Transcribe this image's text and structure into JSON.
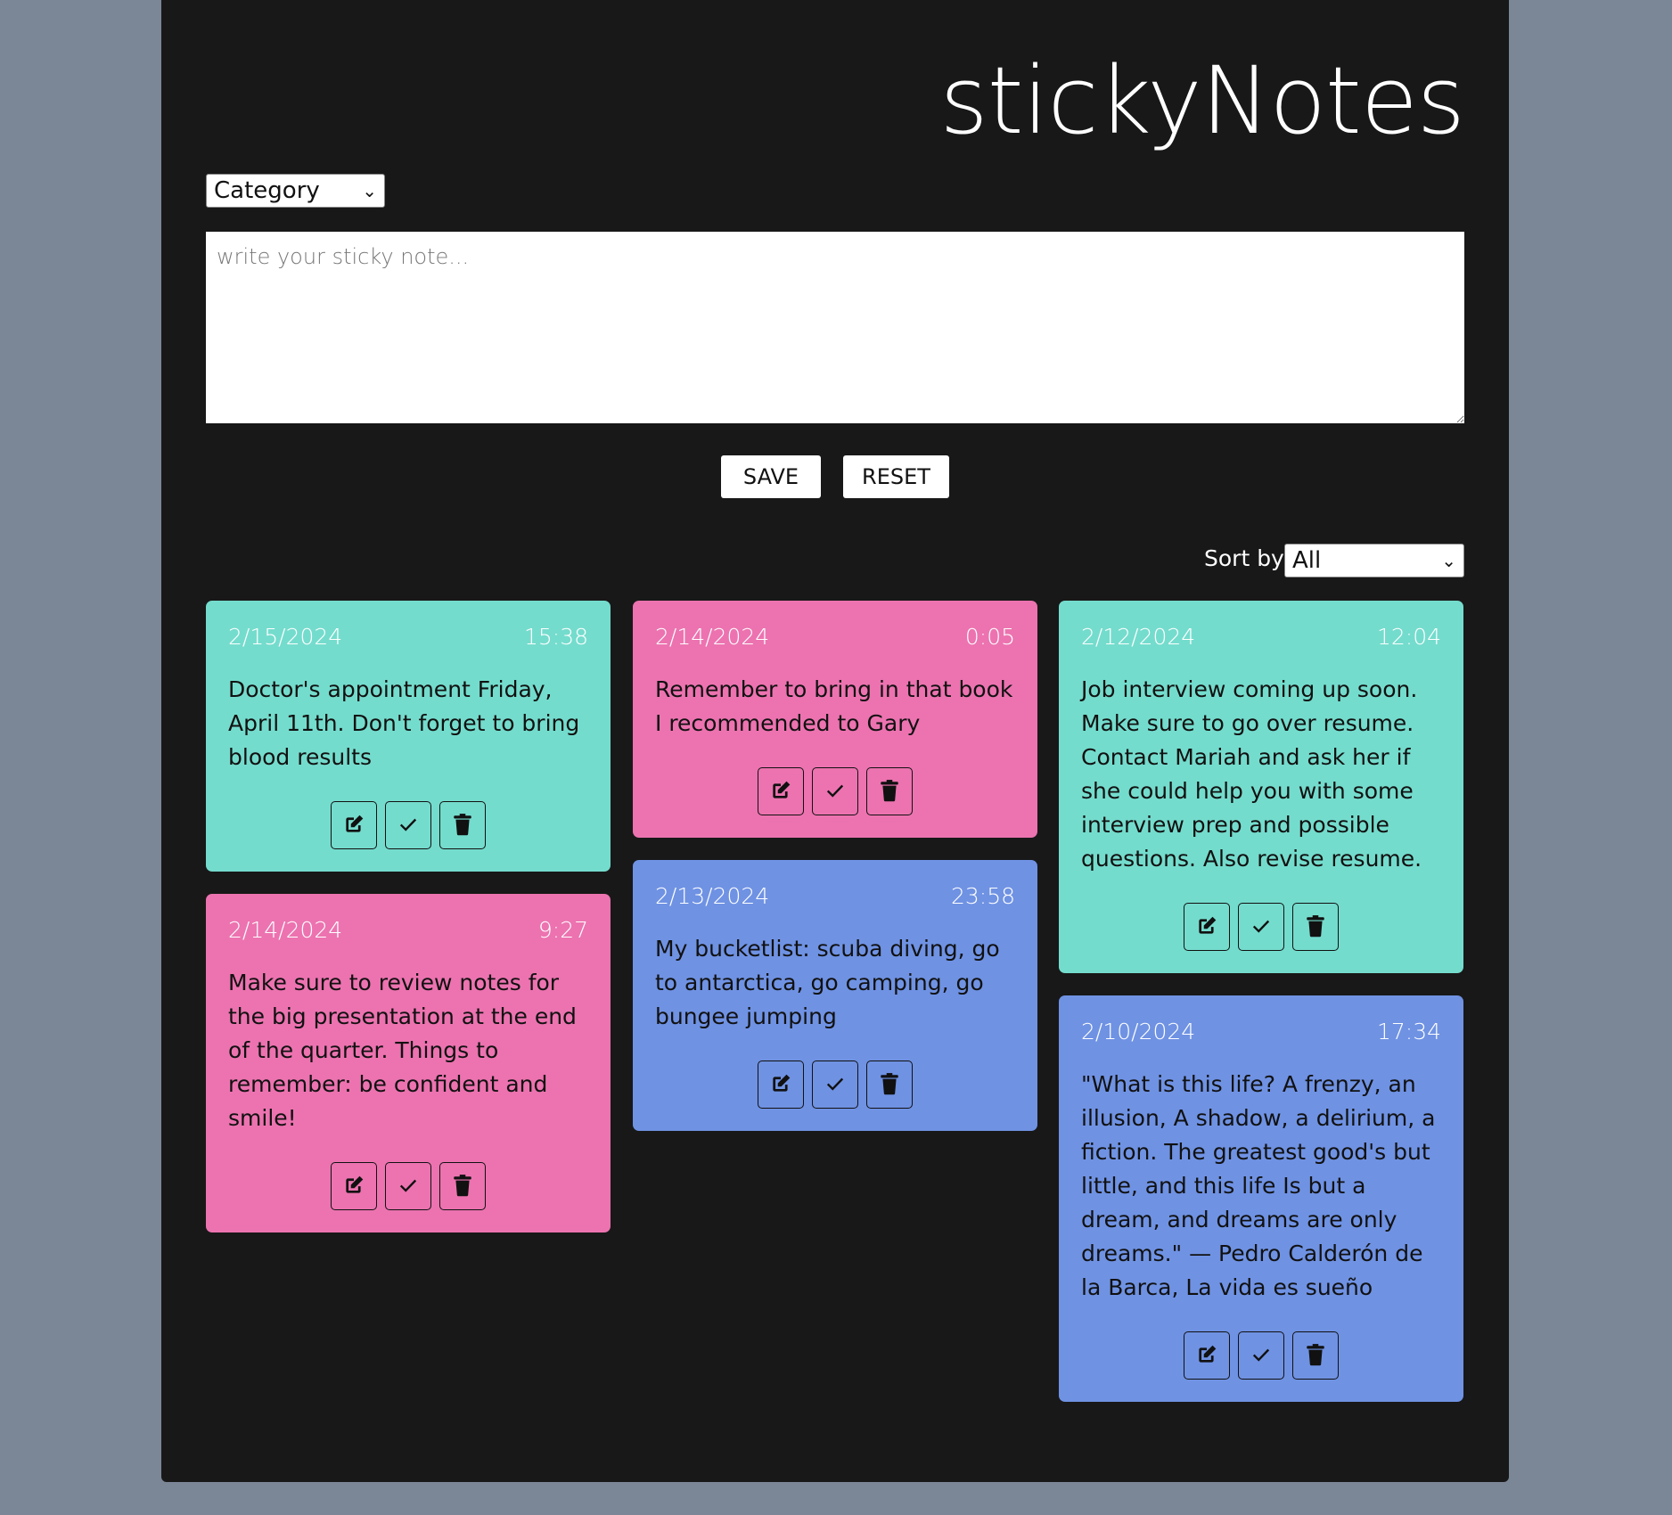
{
  "app": {
    "title": "stickyNotes"
  },
  "form": {
    "category_value": "Category",
    "placeholder": "write your sticky note...",
    "save_label": "SAVE",
    "reset_label": "RESET"
  },
  "sort": {
    "label": "Sort by:",
    "value": "All"
  },
  "colors": {
    "teal": "#74dccd",
    "pink": "#ec73b0",
    "blue": "#6f92e3",
    "background": "#181818"
  },
  "notes": [
    {
      "date": "2/15/2024",
      "time": "15:38",
      "text": "Doctor's appointment Friday, April 11th. Don't forget to bring blood results",
      "color": "teal"
    },
    {
      "date": "2/14/2024",
      "time": "9:27",
      "text": "Make sure to review notes for the big presentation at the end of the quarter. Things to remember: be confident and smile!",
      "color": "pink"
    },
    {
      "date": "2/14/2024",
      "time": "0:05",
      "text": "Remember to bring in that book I recommended to Gary",
      "color": "pink"
    },
    {
      "date": "2/13/2024",
      "time": "23:58",
      "text": "My bucketlist: scuba diving, go to antarctica, go camping, go bungee jumping",
      "color": "blue"
    },
    {
      "date": "2/12/2024",
      "time": "12:04",
      "text": "Job interview coming up soon. Make sure to go over resume. Contact Mariah and ask her if she could help you with some interview prep and possible questions. Also revise resume.",
      "color": "teal"
    },
    {
      "date": "2/10/2024",
      "time": "17:34",
      "text": "\"What is this life? A frenzy, an illusion, A shadow, a delirium, a fiction. The greatest good's but little, and this life Is but a dream, and dreams are only dreams.\" — Pedro Calderón de la Barca, La vida es sueño",
      "color": "blue"
    }
  ],
  "icons": {
    "edit": "edit-icon",
    "complete": "check-icon",
    "delete": "trash-icon"
  }
}
